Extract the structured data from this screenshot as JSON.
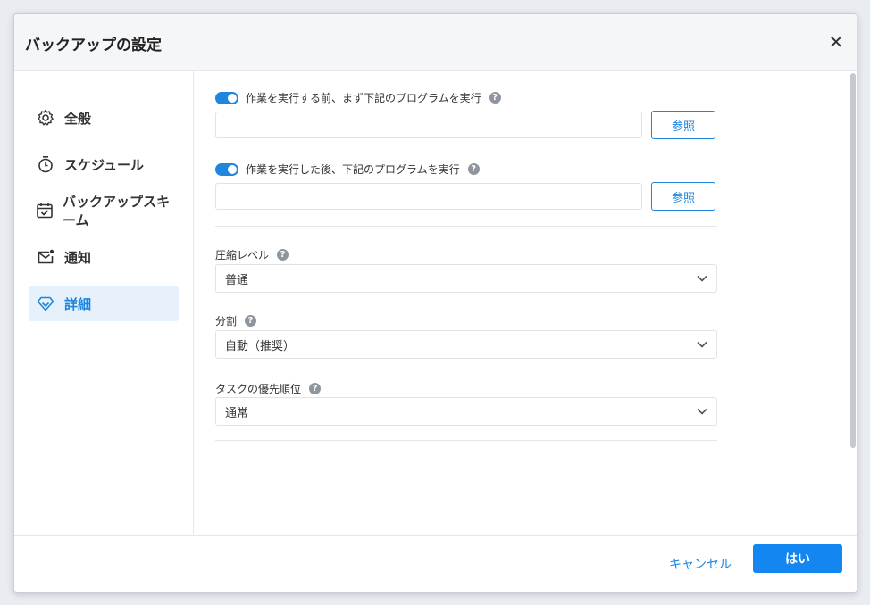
{
  "dialog": {
    "title": "バックアップの設定",
    "close_icon": "close-icon"
  },
  "sidebar": {
    "items": [
      {
        "label": "全般",
        "icon": "gear-icon"
      },
      {
        "label": "スケジュール",
        "icon": "timer-icon"
      },
      {
        "label": "バックアップスキーム",
        "icon": "calendar-check-icon"
      },
      {
        "label": "通知",
        "icon": "mail-notification-icon"
      },
      {
        "label": "詳細",
        "icon": "diamond-icon",
        "active": true
      }
    ]
  },
  "pre_program": {
    "enabled": true,
    "label": "作業を実行する前、まず下記のプログラムを実行",
    "path_value": "",
    "browse_label": "参照"
  },
  "post_program": {
    "enabled": true,
    "label": "作業を実行した後、下記のプログラムを実行",
    "path_value": "",
    "browse_label": "参照"
  },
  "compression": {
    "label": "圧縮レベル",
    "value": "普通"
  },
  "split": {
    "label": "分割",
    "value": "自動（推奨）"
  },
  "priority": {
    "label": "タスクの優先順位",
    "value": "通常"
  },
  "footer": {
    "cancel_label": "キャンセル",
    "ok_label": "はい"
  },
  "colors": {
    "accent": "#1f86e0",
    "primary_button": "#1486f2",
    "active_bg": "#e6f1fc"
  }
}
